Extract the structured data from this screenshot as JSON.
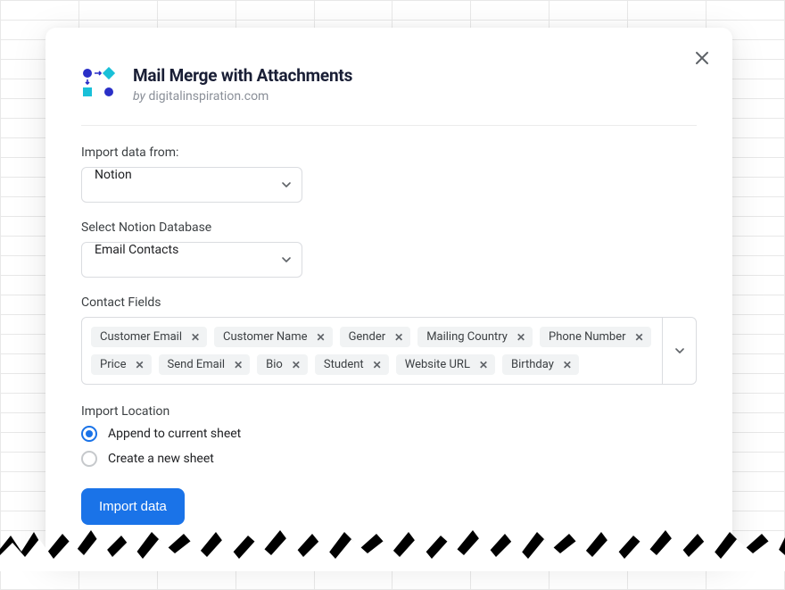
{
  "header": {
    "title": "Mail Merge with Attachments",
    "by_prefix": "by",
    "by_domain": "digitalinspiration.com"
  },
  "import_from": {
    "label": "Import data from:",
    "value": "Notion"
  },
  "database": {
    "label": "Select Notion Database",
    "value": "Email Contacts"
  },
  "contact_fields": {
    "label": "Contact Fields",
    "chips": [
      "Customer Email",
      "Customer Name",
      "Gender",
      "Mailing Country",
      "Phone Number",
      "Price",
      "Send Email",
      "Bio",
      "Student",
      "Website URL",
      "Birthday"
    ]
  },
  "import_location": {
    "label": "Import Location",
    "options": [
      {
        "label": "Append to current sheet",
        "selected": true
      },
      {
        "label": "Create a new sheet",
        "selected": false
      }
    ]
  },
  "actions": {
    "import_button": "Import data"
  }
}
